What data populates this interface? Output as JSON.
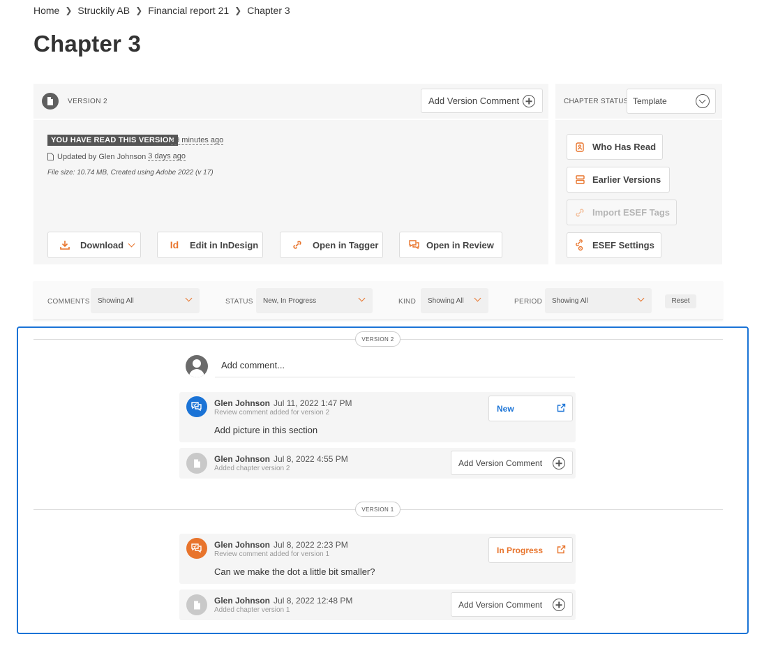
{
  "breadcrumb": [
    "Home",
    "Struckily AB",
    "Financial report 21",
    "Chapter 3"
  ],
  "page_title": "Chapter 3",
  "version_panel": {
    "label": "VERSION 2",
    "add_comment_label": "Add Version Comment",
    "read_badge": "YOU HAVE READ THIS VERSION",
    "read_time": "29 minutes ago",
    "updated_prefix": "Updated by Glen Johnson",
    "updated_time": "3 days ago",
    "file_info": "File size: 10.74 MB, Created using Adobe 2022 (v 17)",
    "actions": {
      "download": "Download",
      "edit_indesign": "Edit in InDesign",
      "open_tagger": "Open in Tagger",
      "open_review": "Open in Review"
    }
  },
  "chapter_status": {
    "label": "CHAPTER STATUS",
    "value": "Template",
    "buttons": {
      "who_has_read": "Who Has Read",
      "earlier_versions": "Earlier Versions",
      "import_esef": "Import ESEF Tags",
      "esef_settings": "ESEF Settings"
    }
  },
  "filters": {
    "comments_label": "COMMENTS",
    "comments_value": "Showing All",
    "status_label": "STATUS",
    "status_value": "New, In Progress",
    "kind_label": "KIND",
    "kind_value": "Showing All",
    "period_label": "PERIOD",
    "period_value": "Showing All",
    "reset_label": "Reset"
  },
  "comments": {
    "placeholder": "Add comment...",
    "version2_pill": "VERSION 2",
    "version1_pill": "VERSION 1",
    "items": [
      {
        "author": "Glen Johnson",
        "date": "Jul 11, 2022 1:47 PM",
        "subtitle": "Review comment added for version 2",
        "text": "Add picture in this section",
        "status": "New",
        "status_color": "#1a73d6"
      },
      {
        "author": "Glen Johnson",
        "date": "Jul 8, 2022 4:55 PM",
        "subtitle": "Added chapter version 2",
        "action": "Add Version Comment"
      },
      {
        "author": "Glen Johnson",
        "date": "Jul 8, 2022 2:23 PM",
        "subtitle": "Review comment added for version 1",
        "text": "Can we make the dot a little bit smaller?",
        "status": "In Progress",
        "status_color": "#e8742c"
      },
      {
        "author": "Glen Johnson",
        "date": "Jul 8, 2022 12:48 PM",
        "subtitle": "Added chapter version 1",
        "action": "Add Version Comment"
      }
    ]
  },
  "colors": {
    "accent_orange": "#e8742c",
    "accent_blue": "#1a73d6"
  }
}
